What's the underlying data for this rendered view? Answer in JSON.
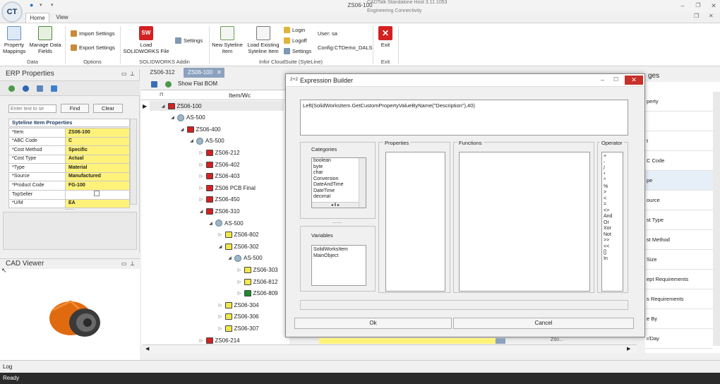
{
  "app": {
    "title": "ZS06-100",
    "sub_line1": "CADTalk Standalone Host 3.11.1053",
    "sub_line2": "Engineering Connectivity",
    "logo": "CT"
  },
  "tabs": [
    "Home",
    "View"
  ],
  "ribbon": {
    "property_mappings": "Property Mappings",
    "manage_data_fields": "Manage Data Fields",
    "import_settings": "Import Settings",
    "export_settings": "Export Settings",
    "load_solidworks_file": "Load SOLIDWORKS File",
    "settings": "Settings",
    "new_syteline_item": "New Syteline Item",
    "load_existing_syteline_item": "Load Existing Syteline Item",
    "login": "Login",
    "logoff": "Logoff",
    "settings2": "Settings",
    "user": "User: sa",
    "config": "Config:CTDemo_DALS",
    "exit": "Exit",
    "groups": {
      "data": "Data",
      "options": "Options",
      "solidworks_addin": "SOLIDWORKS Addin",
      "infor": "Infor CloudSuite (SyteLine)",
      "exit": "Exit"
    }
  },
  "erp": {
    "title": "ERP Properties",
    "search_placeholder": "Enter text to se",
    "find": "Find",
    "clear": "Clear",
    "section": "Syteline Item Properties",
    "rows": [
      {
        "k": "*Item",
        "v": "ZS06-100"
      },
      {
        "k": "*ABC Code",
        "v": "C"
      },
      {
        "k": "*Cost Method",
        "v": "Specific"
      },
      {
        "k": "*Cost Type",
        "v": "Actual"
      },
      {
        "k": "*Type",
        "v": "Material"
      },
      {
        "k": "*Source",
        "v": "Manufactured"
      },
      {
        "k": "*Product Code",
        "v": "FG-100"
      },
      {
        "k": "TopSeller",
        "v": ""
      },
      {
        "k": "*U/M",
        "v": "EA"
      }
    ]
  },
  "cad": {
    "title": "CAD Viewer"
  },
  "doc_tabs": [
    "ZS06-312",
    "ZS06-100"
  ],
  "toolbar": {
    "flat_bom": "Show Flat BOM"
  },
  "tree_header": "Item/Wc",
  "tree": [
    {
      "label": "ZS06-100",
      "type": "red",
      "arrow": "◢"
    },
    {
      "label": "AS-500",
      "type": "gear",
      "arrow": "◢"
    },
    {
      "label": "ZS06-400",
      "type": "red",
      "arrow": "◢"
    },
    {
      "label": "AS-500",
      "type": "gear",
      "arrow": "◢"
    },
    {
      "label": "ZS06-212",
      "type": "red",
      "arrow": "▷"
    },
    {
      "label": "ZS06-402",
      "type": "red",
      "arrow": "▷"
    },
    {
      "label": "ZS06-403",
      "type": "red",
      "arrow": "▷"
    },
    {
      "label": "ZS06 PCB Final",
      "type": "red",
      "arrow": "▷"
    },
    {
      "label": "ZS06-450",
      "type": "red",
      "arrow": "▷"
    },
    {
      "label": "ZS06-310",
      "type": "red",
      "arrow": "◢"
    },
    {
      "label": "AS-500",
      "type": "gear",
      "arrow": "◢"
    },
    {
      "label": "ZS06-802",
      "type": "yel",
      "arrow": "▷"
    },
    {
      "label": "ZS06-302",
      "type": "yel",
      "arrow": "◢"
    },
    {
      "label": "AS-500",
      "type": "gear",
      "arrow": "◢"
    },
    {
      "label": "ZS06-303",
      "type": "yel",
      "arrow": "▷"
    },
    {
      "label": "ZS06-812",
      "type": "yel",
      "arrow": "▷"
    },
    {
      "label": "ZS06-809",
      "type": "grn",
      "arrow": "▷"
    },
    {
      "label": "ZS06-304",
      "type": "yel",
      "arrow": "▷"
    },
    {
      "label": "ZS06-306",
      "type": "yel",
      "arrow": "▷"
    },
    {
      "label": "ZS06-307",
      "type": "yel",
      "arrow": "▷"
    },
    {
      "label": "ZS06-214",
      "type": "red",
      "arrow": "▷"
    }
  ],
  "modal": {
    "icon": "2+2",
    "title": "Expression Builder",
    "expression": "Left(SolidWorksItem.GetCustomPropertyValueByName(\"Description\"),40)",
    "categories_label": "Categories",
    "categories": [
      "boolean",
      "byte",
      "char",
      "Conversion",
      "DateAndTime",
      "DateTime",
      "decimal"
    ],
    "properties_label": "Properties",
    "functions_label": "Functions",
    "operator_label": "Operator",
    "operators": [
      "+",
      "-",
      "/",
      "*",
      "^",
      "%",
      ">",
      "<",
      "=",
      "<>",
      "And",
      "Or",
      "Xor",
      "Not",
      ">>",
      "<<",
      "[]",
      "In"
    ],
    "variables_label": "Variables",
    "variables": [
      "SolidWorksItem",
      "MainObject"
    ],
    "ok": "Ok",
    "cancel": "Cancel"
  },
  "right_panel": {
    "title": "ges",
    "items": [
      "perty",
      "",
      "t",
      "C Code",
      "pe",
      "ource",
      "st Type",
      "st Method",
      "Size",
      "ept Requirements",
      "s Requirements",
      "e By",
      "r/Day"
    ]
  },
  "bottom_row": {
    "text": "ZS0..."
  },
  "log": "Log",
  "status": "Ready",
  "colors": {
    "accent": "#1b6fd1",
    "yellow": "#fff27a",
    "exit_red": "#d42020"
  }
}
